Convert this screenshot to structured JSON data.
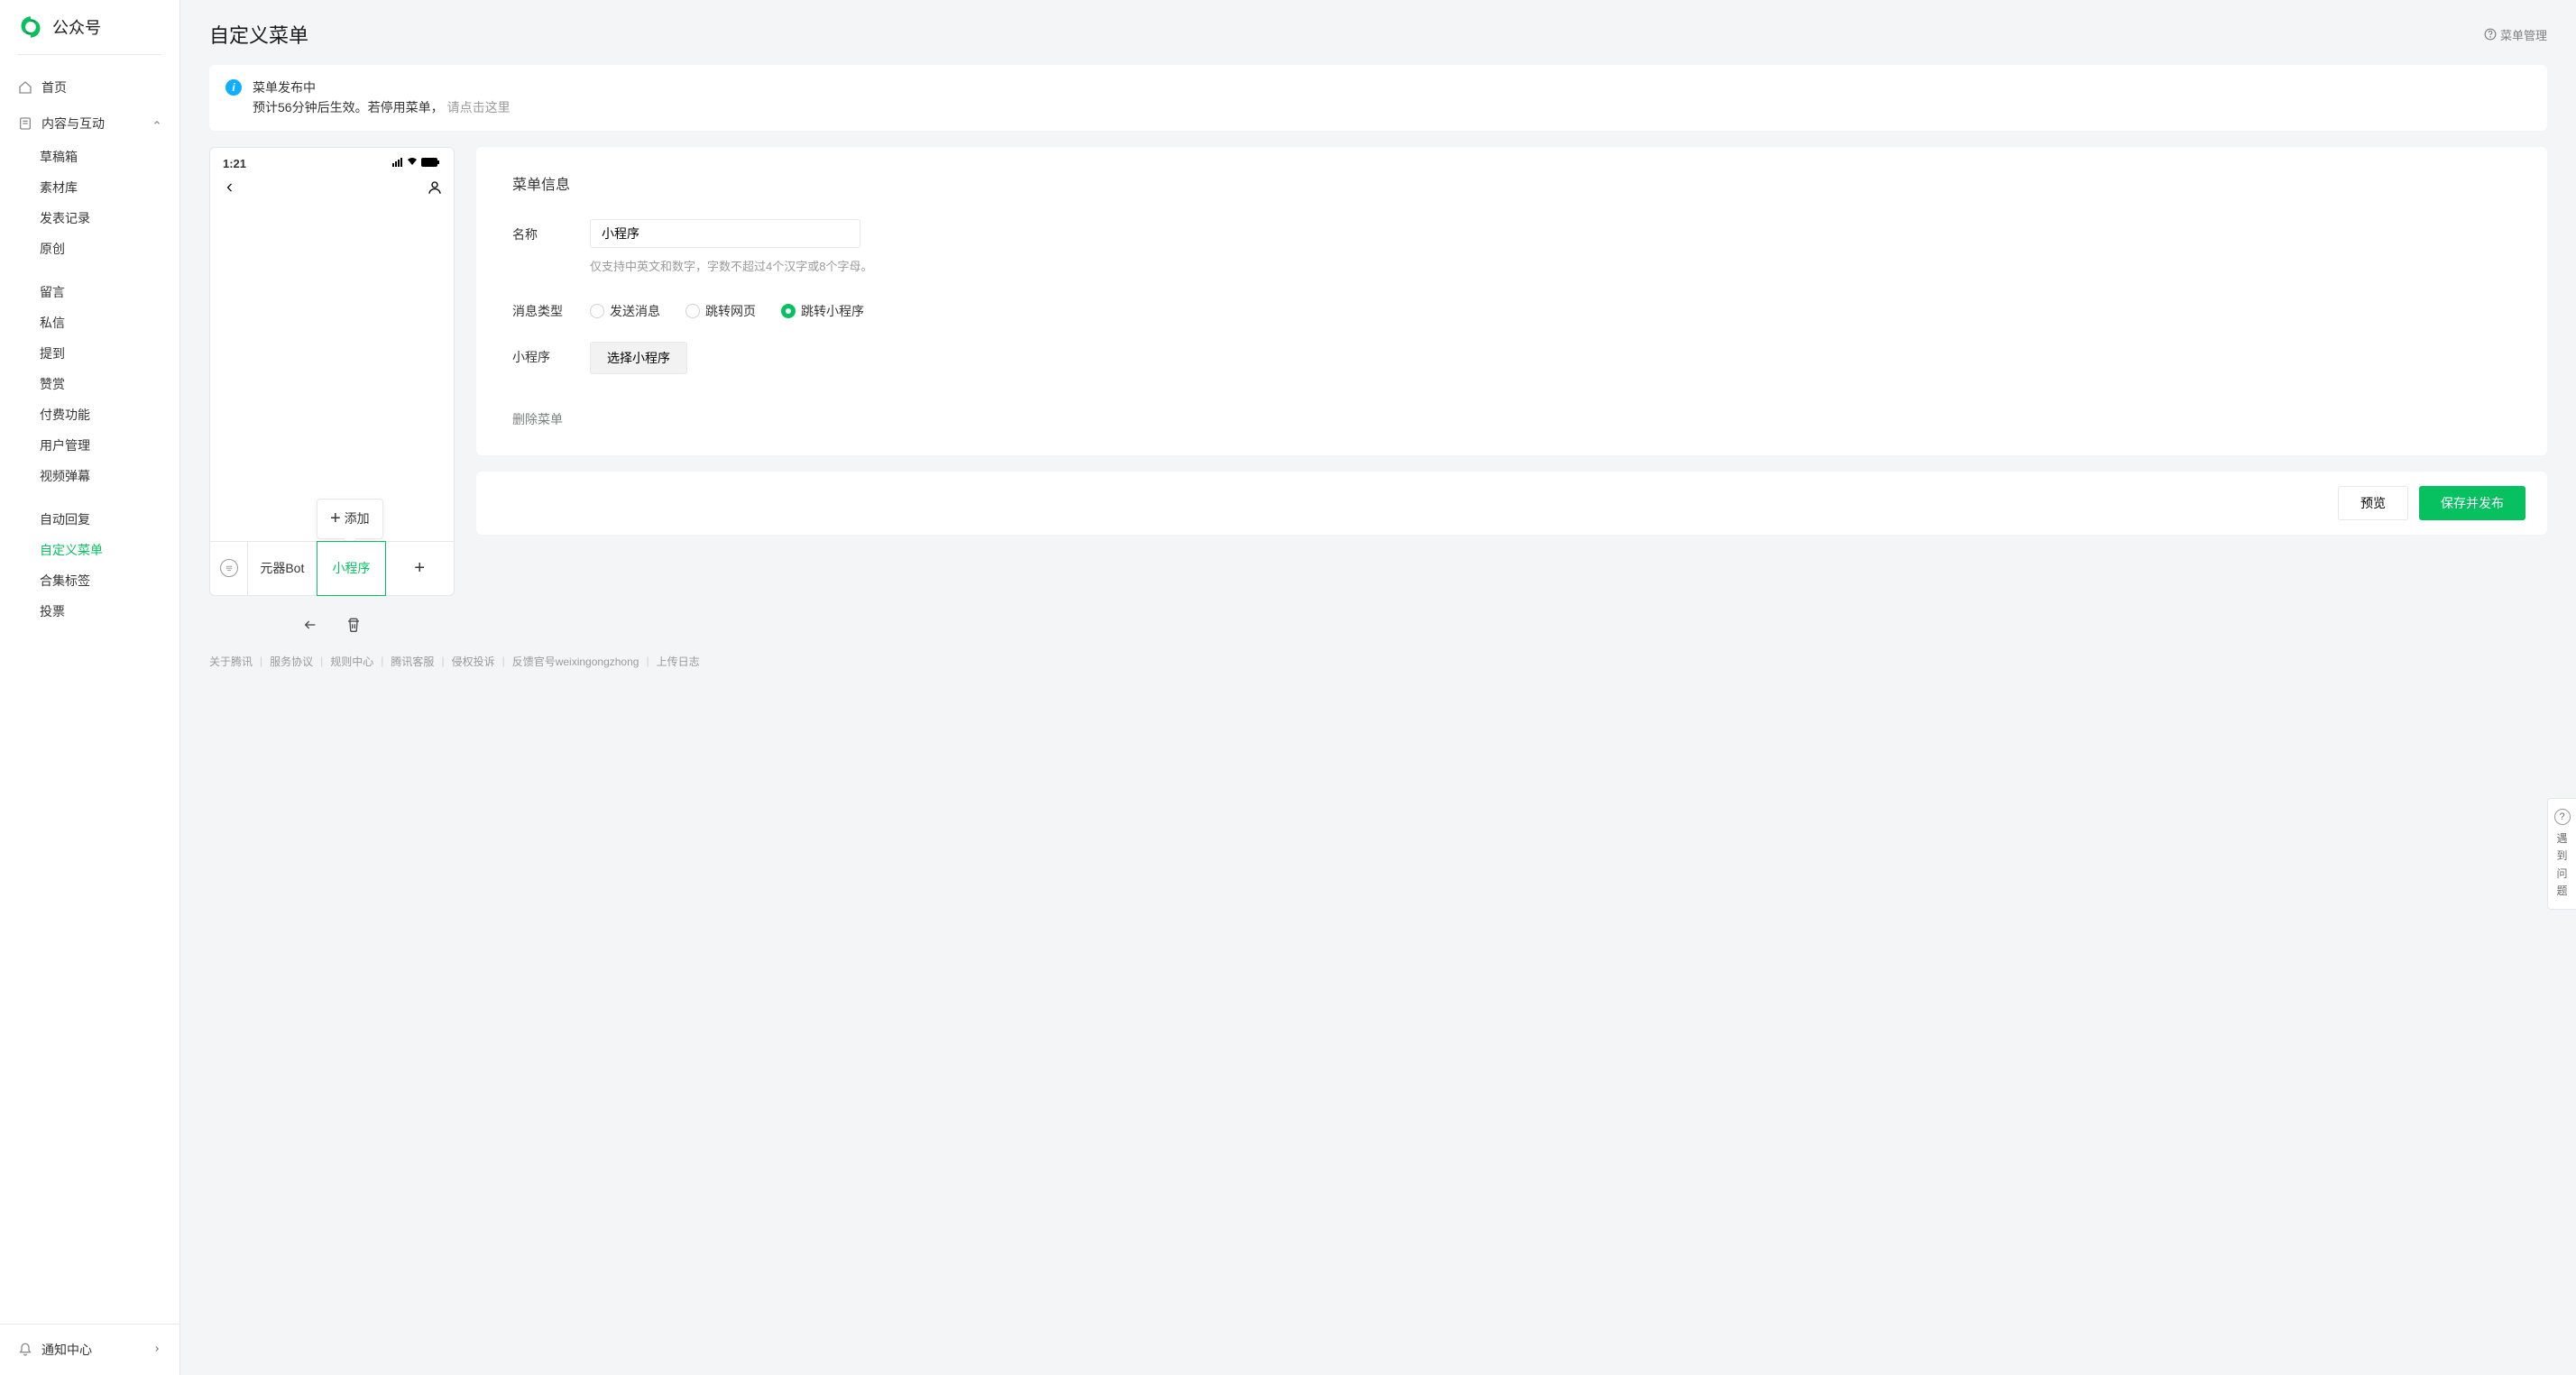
{
  "brand": "公众号",
  "page_title": "自定义菜单",
  "header_help": "菜单管理",
  "sidebar": {
    "home": "首页",
    "content_group": "内容与互动",
    "items": [
      "草稿箱",
      "素材库",
      "发表记录",
      "原创"
    ],
    "items2": [
      "留言",
      "私信",
      "提到",
      "赞赏",
      "付费功能",
      "用户管理",
      "视频弹幕"
    ],
    "items3": [
      "自动回复",
      "自定义菜单",
      "合集标签",
      "投票"
    ],
    "notify": "通知中心"
  },
  "notice": {
    "title": "菜单发布中",
    "desc": "预计56分钟后生效。若停用菜单，",
    "link": "请点击这里"
  },
  "phone": {
    "time": "1:21",
    "submenu_add": "添加",
    "menus": [
      "元器Bot",
      "小程序"
    ]
  },
  "panel": {
    "title": "菜单信息",
    "name_label": "名称",
    "name_value": "小程序",
    "name_hint": "仅支持中英文和数字，字数不超过4个汉字或8个字母。",
    "type_label": "消息类型",
    "radios": [
      "发送消息",
      "跳转网页",
      "跳转小程序"
    ],
    "miniapp_label": "小程序",
    "select_miniapp": "选择小程序",
    "delete": "删除菜单"
  },
  "actions": {
    "preview": "预览",
    "publish": "保存并发布"
  },
  "footer": [
    "关于腾讯",
    "服务协议",
    "规则中心",
    "腾讯客服",
    "侵权投诉",
    "反馈官号weixingongzhong",
    "上传日志"
  ],
  "float_help": "遇到问题"
}
